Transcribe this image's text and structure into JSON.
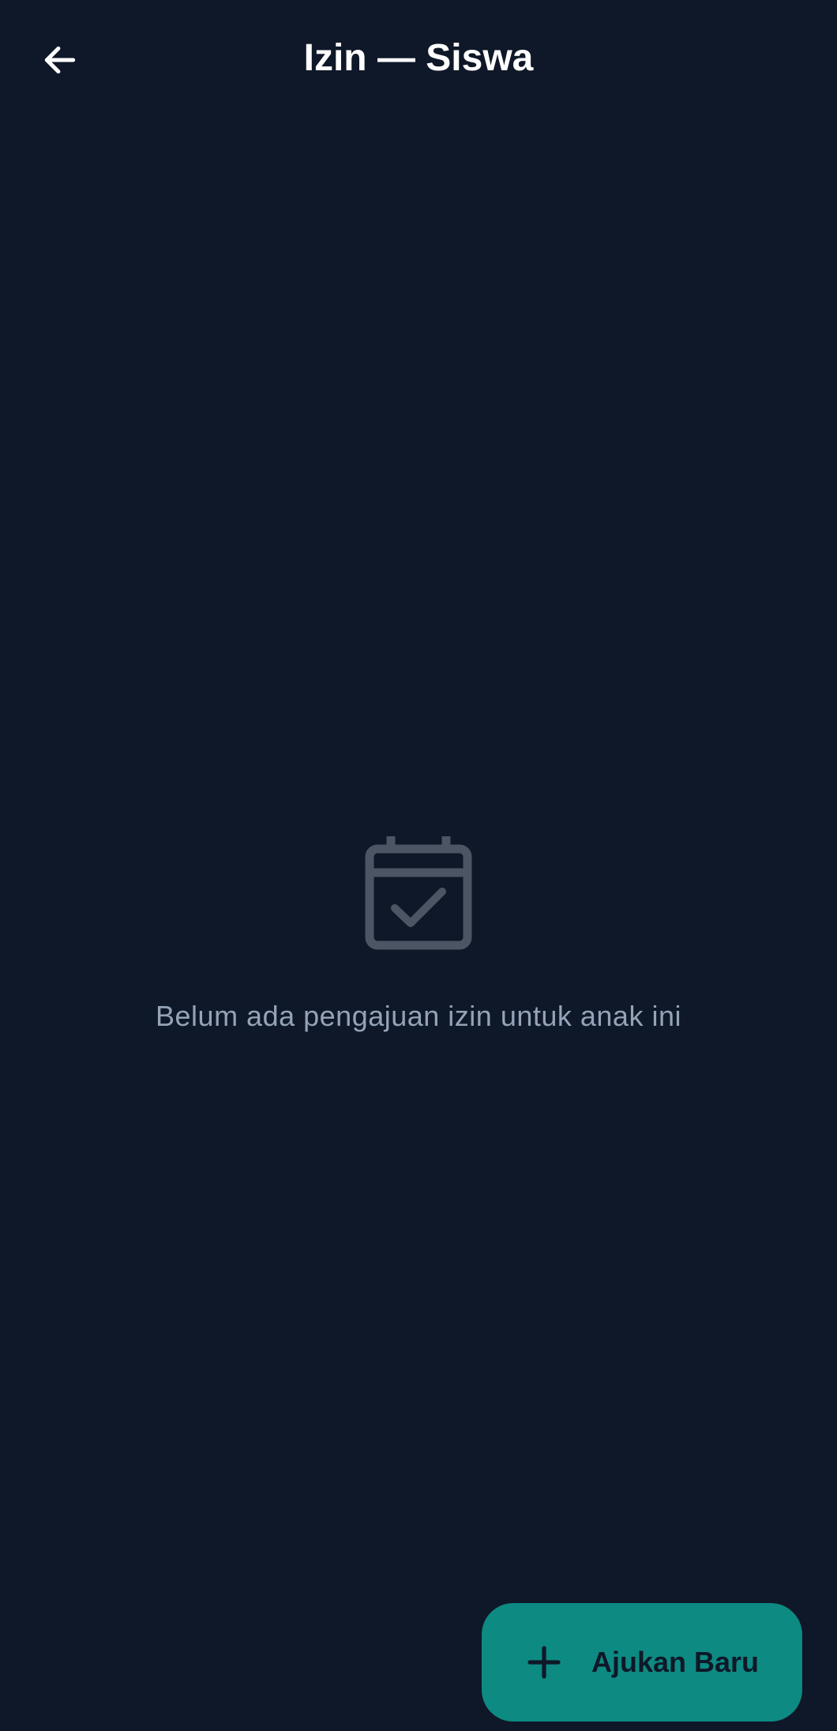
{
  "app_bar": {
    "title": "Izin — Siswa",
    "back_icon": "arrow-left-icon"
  },
  "empty_state": {
    "icon": "calendar-check-icon",
    "message": "Belum ada pengajuan izin untuk anak ini"
  },
  "fab": {
    "icon": "plus-icon",
    "label": "Ajukan Baru"
  },
  "colors": {
    "background": "#0f1828",
    "title_text": "#ffffff",
    "muted_icon": "#4b5563",
    "muted_text": "#94a3b8",
    "accent": "#0d8a82",
    "fab_content": "#0f1828"
  }
}
